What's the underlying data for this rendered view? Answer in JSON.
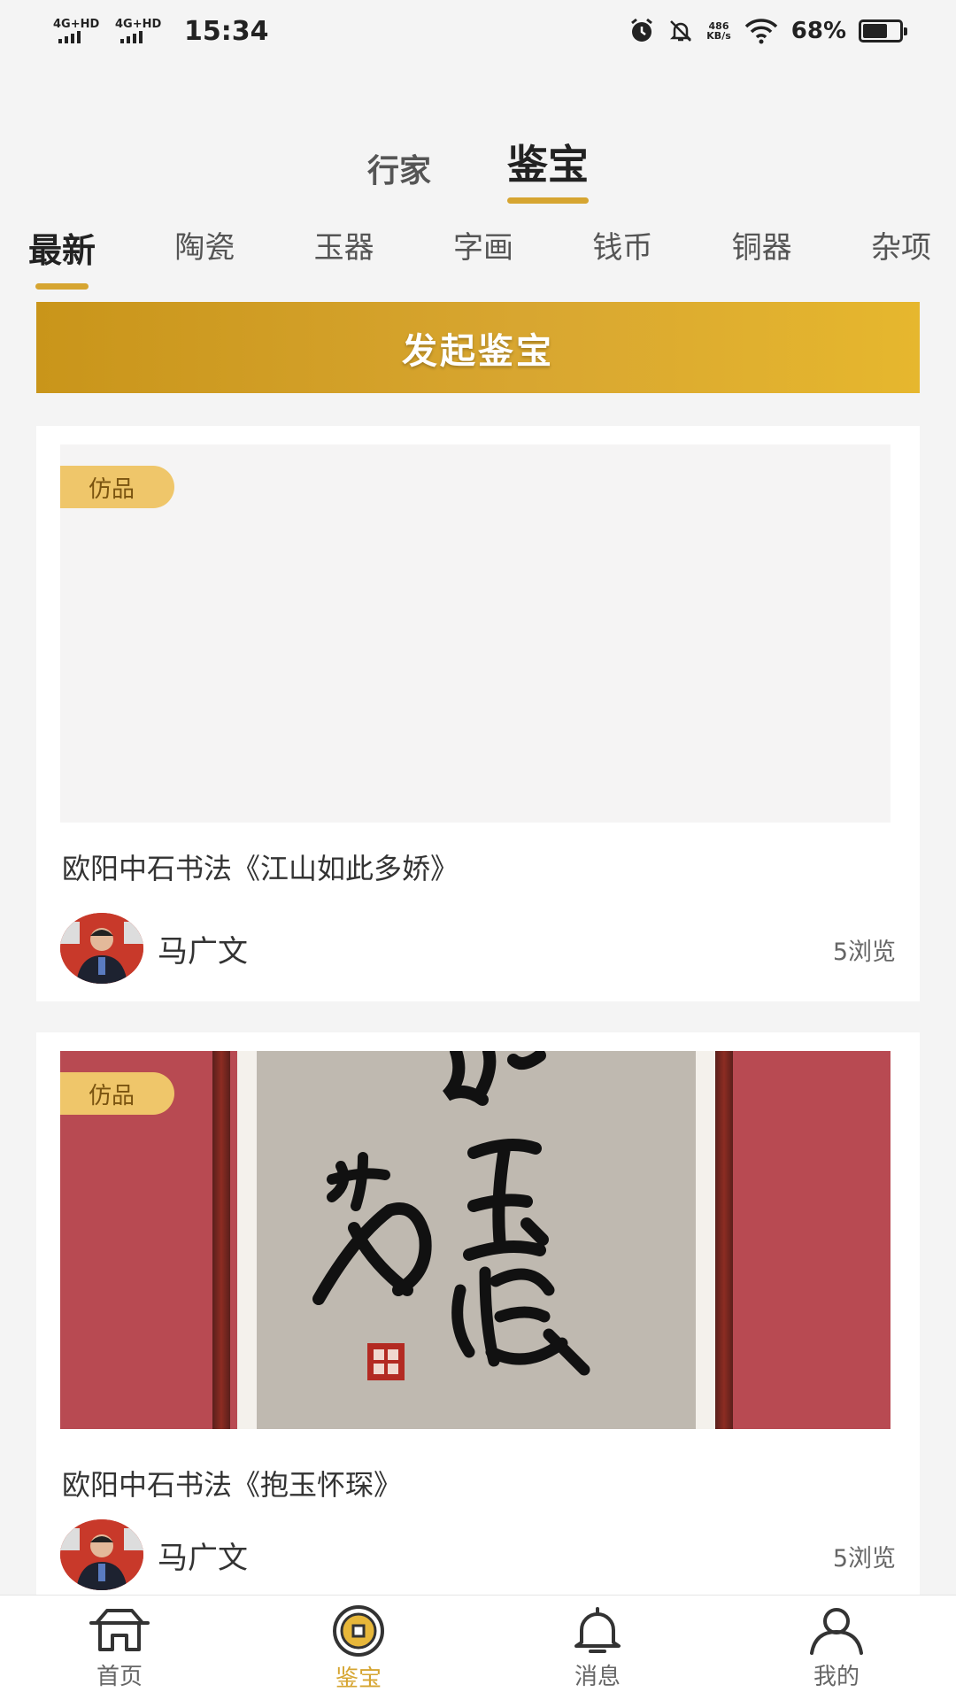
{
  "status_bar": {
    "signal1": "4G+HD",
    "signal2": "4G+HD",
    "time": "15:34",
    "net_speed_value": "486",
    "net_speed_unit": "KB/s",
    "battery": "68%",
    "battery_level": 0.68
  },
  "top_tabs": [
    {
      "label": "行家",
      "active": false
    },
    {
      "label": "鉴宝",
      "active": true
    }
  ],
  "categories": [
    {
      "label": "最新",
      "active": true
    },
    {
      "label": "陶瓷",
      "active": false
    },
    {
      "label": "玉器",
      "active": false
    },
    {
      "label": "字画",
      "active": false
    },
    {
      "label": "钱币",
      "active": false
    },
    {
      "label": "铜器",
      "active": false
    },
    {
      "label": "杂项",
      "active": false
    }
  ],
  "launch_button": "发起鉴宝",
  "posts": [
    {
      "badge": "仿品",
      "title": "欧阳中石书法《江山如此多娇》",
      "user": "马广文",
      "views": "5浏览",
      "image": "blank"
    },
    {
      "badge": "仿品",
      "title": "欧阳中石书法《抱玉怀琛》",
      "user": "马广文",
      "views": "5浏览",
      "image": "calligraphy"
    }
  ],
  "bottom_nav": [
    {
      "label": "首页",
      "icon": "home-icon",
      "active": false
    },
    {
      "label": "鉴宝",
      "icon": "coin-icon",
      "active": true
    },
    {
      "label": "消息",
      "icon": "bell-icon",
      "active": false
    },
    {
      "label": "我的",
      "icon": "user-icon",
      "active": false
    }
  ],
  "colors": {
    "accent": "#d6a531",
    "badge_bg": "#efc66a",
    "background": "#f4f4f4"
  }
}
